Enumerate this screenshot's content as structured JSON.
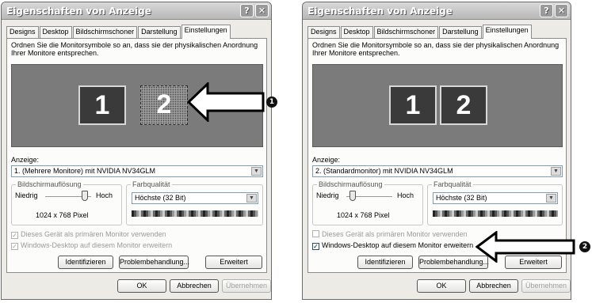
{
  "dialogs": [
    {
      "title": "Eigenschaften von Anzeige",
      "help_btn": "?",
      "close_btn": "✕",
      "tabs": [
        "Designs",
        "Desktop",
        "Bildschirmschoner",
        "Darstellung",
        "Einstellungen"
      ],
      "active_tab": "Einstellungen",
      "description": "Ordnen Sie die Monitorsymbole so an, dass sie der physikalischen Anordnung Ihrer Monitore entsprechen.",
      "monitors": [
        "1",
        "2"
      ],
      "display_label": "Anzeige:",
      "display_value": "1. (Mehrere Monitore) mit NVIDIA NV34GLM",
      "resolution_group": "Bildschirmauflösung",
      "res_low": "Niedrig",
      "res_high": "Hoch",
      "resolution": "1024 x 768 Pixel",
      "color_group": "Farbqualität",
      "color_value": "Höchste (32 Bit)",
      "primary_check": "Dieses Gerät als primären Monitor verwenden",
      "extend_check": "Windows-Desktop auf diesem Monitor erweitern",
      "identify_btn": "Identifizieren",
      "troubleshoot_btn": "Problembehandlung...",
      "advanced_btn": "Erweitert",
      "ok_btn": "OK",
      "cancel_btn": "Abbrechen",
      "apply_btn": "Übernehmen",
      "callout_number": "1"
    },
    {
      "title": "Eigenschaften von Anzeige",
      "help_btn": "?",
      "close_btn": "✕",
      "tabs": [
        "Designs",
        "Desktop",
        "Bildschirmschoner",
        "Darstellung",
        "Einstellungen"
      ],
      "active_tab": "Einstellungen",
      "description": "Ordnen Sie die Monitorsymbole so an, dass sie der physikalischen Anordnung Ihrer Monitore entsprechen.",
      "monitors": [
        "1",
        "2"
      ],
      "display_label": "Anzeige:",
      "display_value": "2. (Standardmonitor) mit NVIDIA NV34GLM",
      "resolution_group": "Bildschirmauflösung",
      "res_low": "Niedrig",
      "res_high": "Hoch",
      "resolution": "1024 x 768 Pixel",
      "color_group": "Farbqualität",
      "color_value": "Höchste (32 Bit)",
      "primary_check": "Dieses Gerät als primären Monitor verwenden",
      "extend_check": "Windows-Desktop auf diesem Monitor erweitern",
      "identify_btn": "Identifizieren",
      "troubleshoot_btn": "Problembehandlung...",
      "advanced_btn": "Erweitert",
      "ok_btn": "OK",
      "cancel_btn": "Abbrechen",
      "apply_btn": "Übernehmen",
      "callout_number": "2"
    }
  ]
}
